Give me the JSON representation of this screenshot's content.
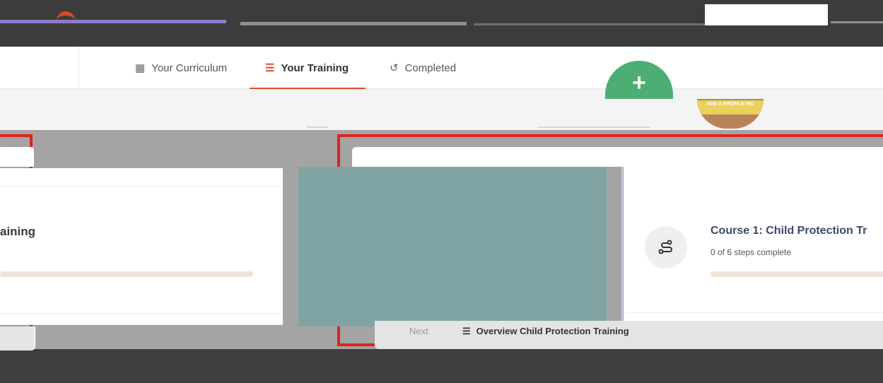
{
  "tabs": [
    {
      "label": "Your Curriculum",
      "icon": "calendar-icon",
      "glyph": "▦"
    },
    {
      "label": "Your Training",
      "icon": "checklist-icon",
      "glyph": "☰"
    },
    {
      "label": "Completed",
      "icon": "history-icon",
      "glyph": "↺"
    }
  ],
  "add_button": {
    "glyph": "+"
  },
  "profile": {
    "label": "ADD A PROFILE PIC"
  },
  "left_card": {
    "title_fragment": "aining"
  },
  "course_card": {
    "title": "Course 1: Child Protection Tr",
    "steps_text": "0 of 6 steps complete",
    "progress": 0,
    "icon": "route-icon",
    "glyph": "ℰ"
  },
  "next_bar": {
    "next_label": "Next",
    "link_glyph": "☰",
    "link_text": "Overview Child Protection Training"
  },
  "colors": {
    "accent": "#e64a2e",
    "add_green": "#4cae73",
    "frame_red": "#e0221c",
    "teal_block": "#80a4a4",
    "progress_track": "#f0e3d8"
  }
}
